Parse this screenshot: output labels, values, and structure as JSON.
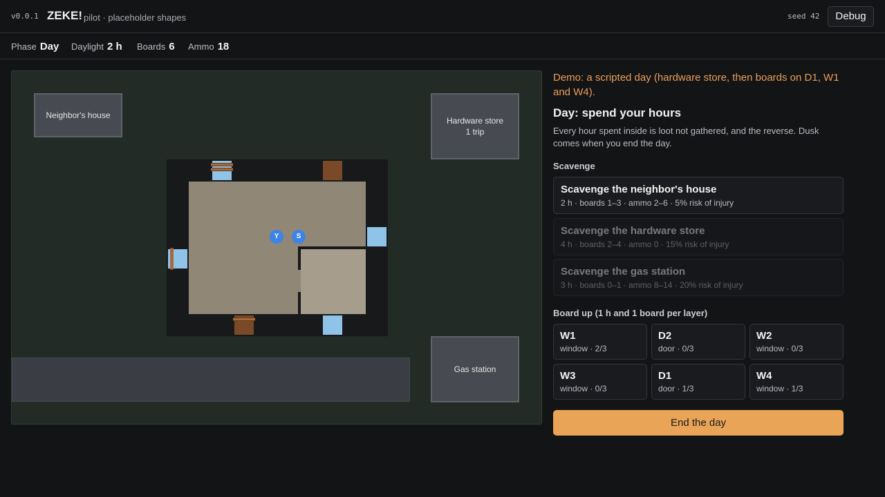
{
  "header": {
    "version": "v0.0.1",
    "title": "ZEKE!",
    "subtitle": "pilot · placeholder shapes",
    "seed": "seed 42",
    "debug_label": "Debug"
  },
  "status": {
    "phase_label": "Phase",
    "phase_value": "Day",
    "daylight_label": "Daylight",
    "daylight_value": "2 h",
    "boards_label": "Boards",
    "boards_value": "6",
    "ammo_label": "Ammo",
    "ammo_value": "18"
  },
  "map": {
    "neighbor_house": "Neighbor's house",
    "hardware_store": "Hardware store",
    "hardware_store_sub": "1 trip",
    "gas_station": "Gas station",
    "tokens": [
      "Y",
      "S"
    ]
  },
  "panel": {
    "demo_note": "Demo: a scripted day (hardware store, then boards on D1, W1 and W4).",
    "day_title": "Day: spend your hours",
    "day_desc": "Every hour spent inside is loot not gathered, and the reverse. Dusk comes when you end the day.",
    "scavenge_heading": "Scavenge",
    "scavenge": [
      {
        "title": "Scavenge the neighbor's house",
        "detail": "2 h · boards 1–3 · ammo 2–6 · 5% risk of injury",
        "enabled": true
      },
      {
        "title": "Scavenge the hardware store",
        "detail": "4 h · boards 2–4 · ammo 0 · 15% risk of injury",
        "enabled": false
      },
      {
        "title": "Scavenge the gas station",
        "detail": "3 h · boards 0–1 · ammo 8–14 · 20% risk of injury",
        "enabled": false
      }
    ],
    "board_heading": "Board up (1 h and 1 board per layer)",
    "openings": [
      {
        "name": "W1",
        "detail": "window · 2/3"
      },
      {
        "name": "D2",
        "detail": "door · 0/3"
      },
      {
        "name": "W2",
        "detail": "window · 0/3"
      },
      {
        "name": "W3",
        "detail": "window · 0/3"
      },
      {
        "name": "D1",
        "detail": "door · 1/3"
      },
      {
        "name": "W4",
        "detail": "window · 1/3"
      }
    ],
    "end_day_label": "End the day"
  },
  "colors": {
    "accent": "#e9a457",
    "demo_text": "#eb9d58",
    "token": "#3d84e6",
    "window": "#8fc3e8",
    "door": "#7a4a28"
  }
}
